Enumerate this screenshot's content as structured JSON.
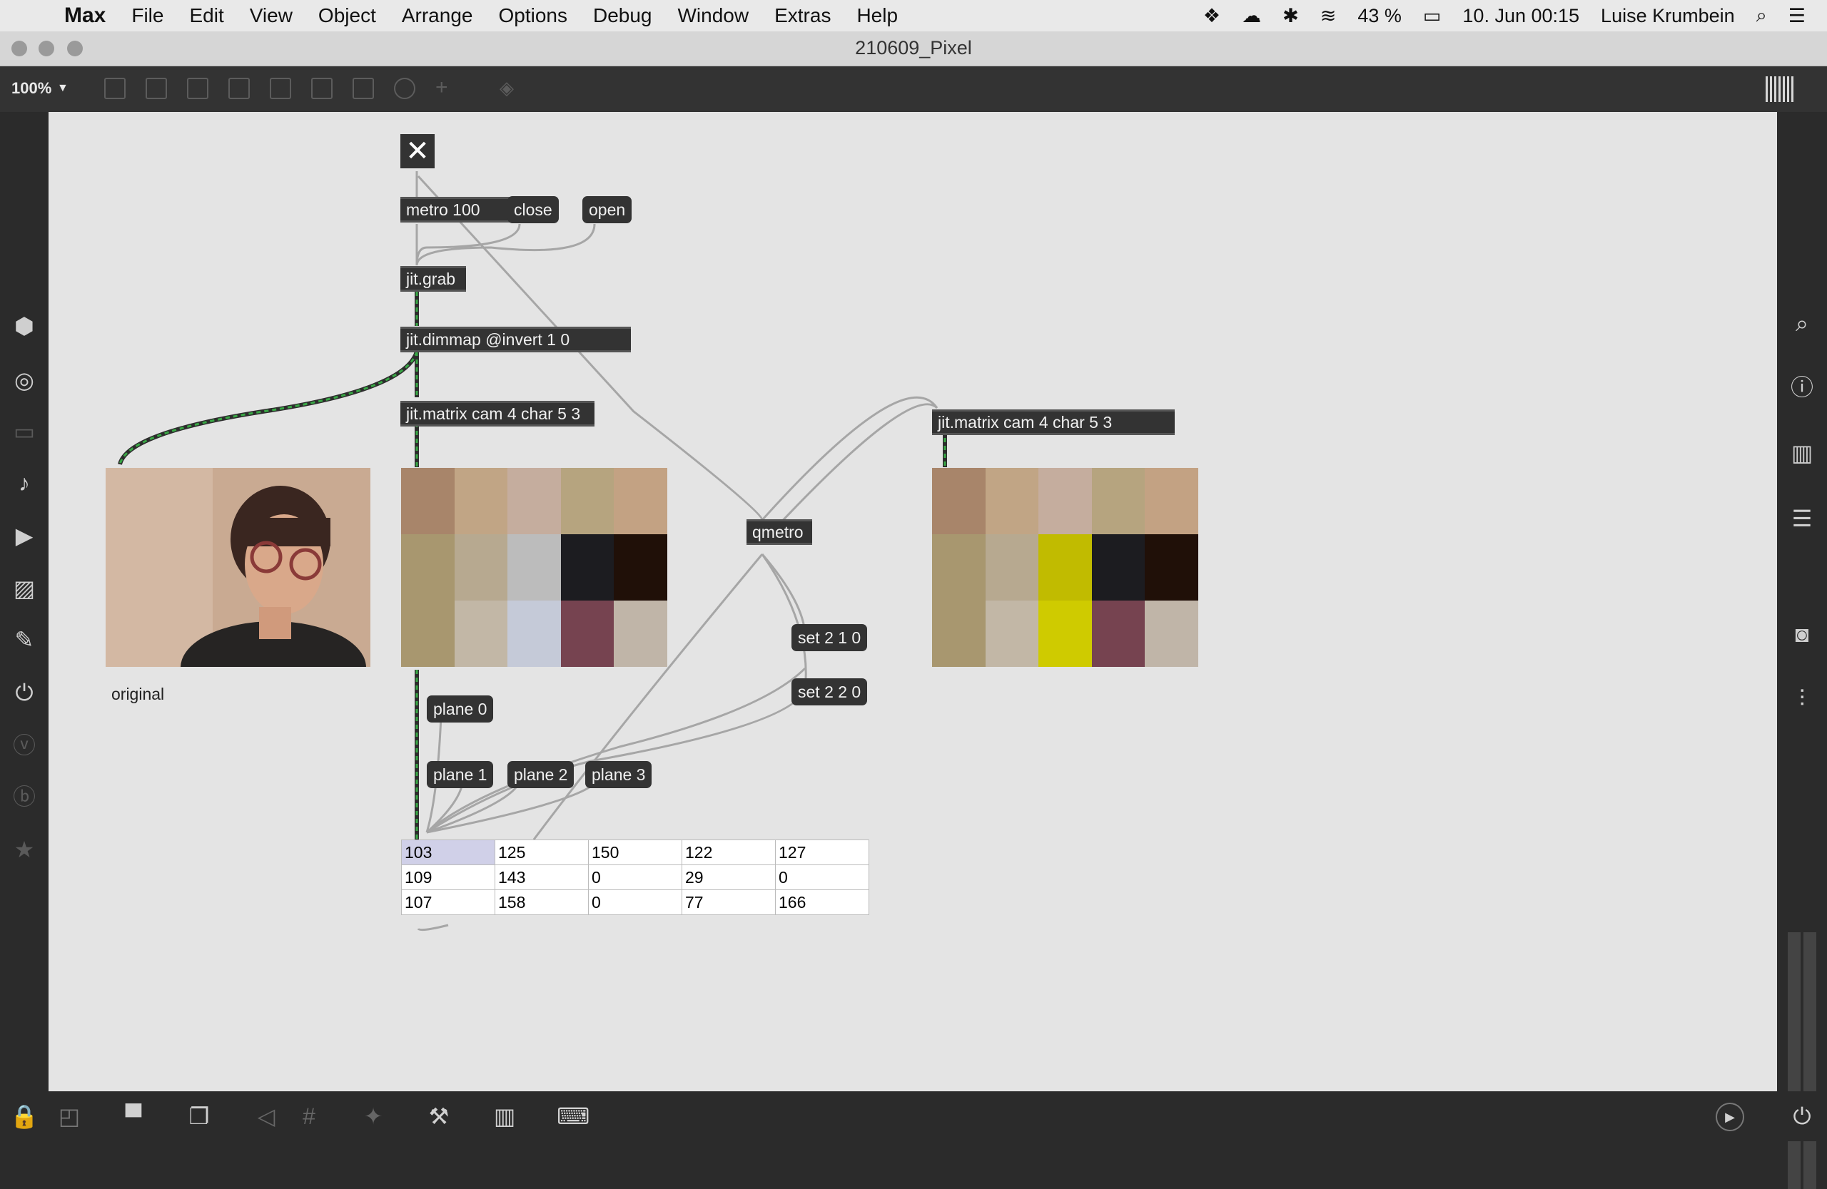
{
  "menubar": {
    "items": [
      "Max",
      "File",
      "Edit",
      "View",
      "Object",
      "Arrange",
      "Options",
      "Debug",
      "Window",
      "Extras",
      "Help"
    ],
    "battery": "43 %",
    "datetime": "10. Jun  00:15",
    "user": "Luise Krumbein"
  },
  "window": {
    "title": "210609_Pixel"
  },
  "toolbar": {
    "zoom": "100%"
  },
  "patch": {
    "objects": {
      "metro": "metro 100",
      "grab": "jit.grab",
      "dimmap": "jit.dimmap @invert 1 0",
      "matrix1": "jit.matrix cam 4 char 5 3",
      "matrix2": "jit.matrix cam 4 char 5 3",
      "qmetro": "qmetro"
    },
    "messages": {
      "close": "close",
      "open": "open",
      "set1": "set 2 1 0",
      "set2": "set 2 2 0",
      "plane0": "plane 0",
      "plane1": "plane 1",
      "plane2": "plane 2",
      "plane3": "plane 3"
    },
    "comment_original": "original",
    "pwindow_colors_left": [
      "#a8856a",
      "#c1a585",
      "#c5ad9e",
      "#b6a47f",
      "#c3a283",
      "#a8976f",
      "#b7a990",
      "#bcbcbc",
      "#1c1c20",
      "#201008",
      "#a8976f",
      "#c2b7a6",
      "#c5cad8",
      "#764350",
      "#c0b5a8"
    ],
    "pwindow_colors_right": [
      "#a8856a",
      "#c1a585",
      "#c5ad9e",
      "#b6a47f",
      "#c3a283",
      "#a8976f",
      "#b7a990",
      "#c1bb00",
      "#1c1c20",
      "#201008",
      "#a8976f",
      "#c2b7a6",
      "#cfcb00",
      "#764350",
      "#c0b5a8"
    ],
    "cellblock": [
      [
        "103",
        "125",
        "150",
        "122",
        "127"
      ],
      [
        "109",
        "143",
        "0",
        "29",
        "0"
      ],
      [
        "107",
        "158",
        "0",
        "77",
        "166"
      ]
    ]
  }
}
